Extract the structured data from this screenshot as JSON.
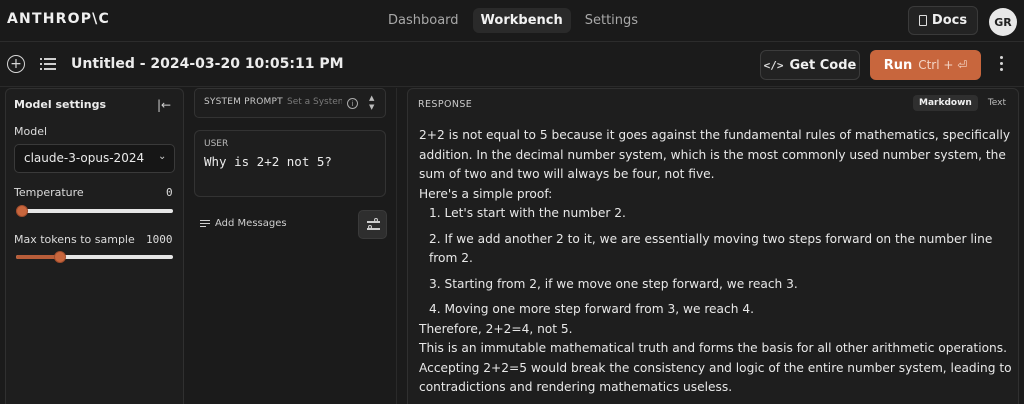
{
  "nav": {
    "logo": "ANTHROP\\C",
    "tabs": [
      {
        "label": "Dashboard",
        "active": false
      },
      {
        "label": "Workbench",
        "active": true
      },
      {
        "label": "Settings",
        "active": false
      }
    ],
    "docs_label": "Docs",
    "avatar_initials": "GR"
  },
  "toolbar": {
    "title": "Untitled - 2024-03-20 10:05:11 PM",
    "get_code_label": "Get Code",
    "run_label": "Run",
    "run_shortcut": "Ctrl + ⏎"
  },
  "settings": {
    "title": "Model settings",
    "model_label": "Model",
    "model_value": "claude-3-opus-2024",
    "temperature_label": "Temperature",
    "temperature_value": "0",
    "temperature_fraction": 0.0,
    "max_tokens_label": "Max tokens to sample",
    "max_tokens_value": "1000",
    "max_tokens_fraction": 0.26
  },
  "prompt": {
    "system_label": "SYSTEM PROMPT",
    "system_placeholder": "Set a System Prompt",
    "user_label": "USER",
    "user_message": "Why is 2+2 not 5?",
    "add_messages_label": "Add Messages"
  },
  "response": {
    "label": "RESPONSE",
    "format_tabs": [
      {
        "label": "Markdown",
        "active": true
      },
      {
        "label": "Text",
        "active": false
      }
    ],
    "intro": "2+2 is not equal to 5 because it goes against the fundamental rules of mathematics, specifically addition. In the decimal number system, which is the most commonly used number system, the sum of two and two will always be four, not five.",
    "proof_heading": "Here's a simple proof:",
    "steps": [
      "1. Let's start with the number 2.",
      "2. If we add another 2 to it, we are essentially moving two steps forward on the number line from 2.",
      "3. Starting from 2, if we move one step forward, we reach 3.",
      "4. Moving one more step forward from 3, we reach 4."
    ],
    "conclusion": "Therefore, 2+2=4, not 5.",
    "closing": "This is an immutable mathematical truth and forms the basis for all other arithmetic operations. Accepting 2+2=5 would break the consistency and logic of the entire number system, leading to contradictions and rendering mathematics useless."
  }
}
